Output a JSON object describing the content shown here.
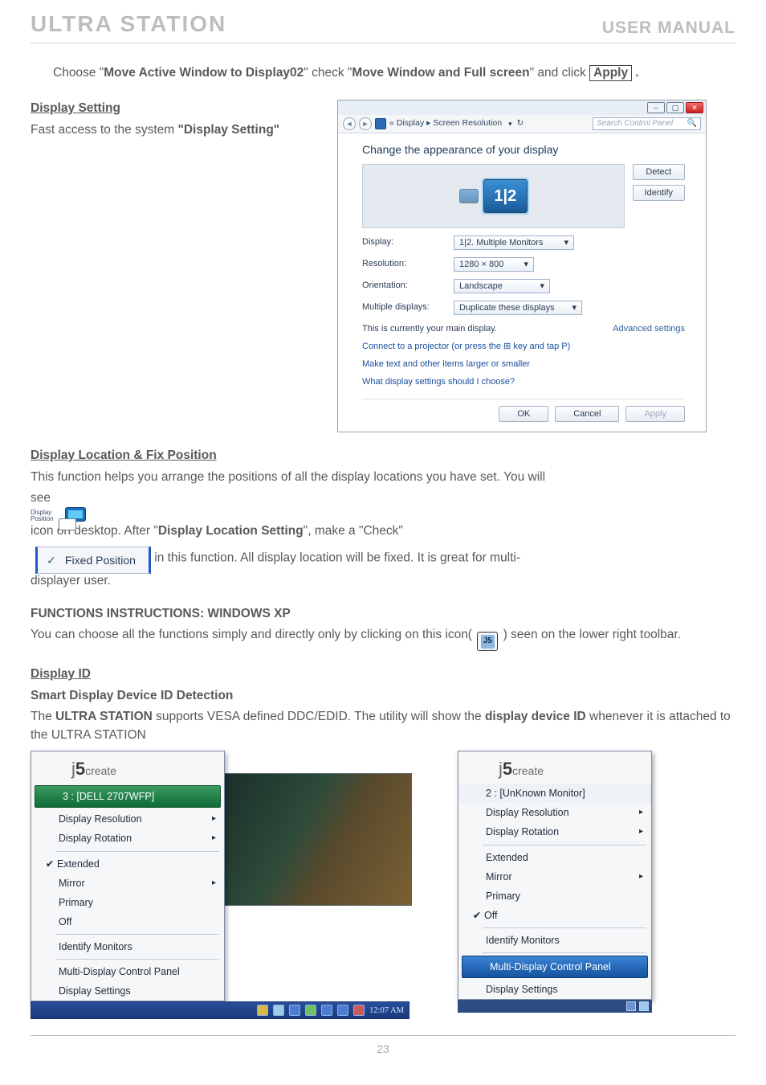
{
  "header": {
    "left": "ULTRA STATION",
    "right": "USER MANUAL"
  },
  "intro": {
    "line1a": "Choose \"",
    "line1b": "Move Active Window to Display02",
    "line1c": "\" check \"",
    "line1d": "Move Window and Full screen",
    "line1e": "\" and click ",
    "apply_label": "Apply",
    "period": " ."
  },
  "display_setting": {
    "heading": "Display Setting",
    "text_a": "Fast access to the system ",
    "text_b": "\"Display Setting\""
  },
  "sr_dialog": {
    "breadcrumb_sep1": "«  ",
    "breadcrumb_a": "Display",
    "breadcrumb_sep2": "  ▸  ",
    "breadcrumb_b": "Screen Resolution",
    "search_placeholder": "Search Control Panel",
    "heading": "Change the appearance of your display",
    "mon_combined": "1|2",
    "btn_detect": "Detect",
    "btn_identify": "Identify",
    "rows": {
      "display": {
        "label": "Display:",
        "value": "1|2. Multiple Monitors"
      },
      "resolution": {
        "label": "Resolution:",
        "value": "1280 × 800"
      },
      "orientation": {
        "label": "Orientation:",
        "value": "Landscape"
      },
      "multiple": {
        "label": "Multiple displays:",
        "value": "Duplicate these displays"
      }
    },
    "main_note": "This is currently your main display.",
    "advanced": "Advanced settings",
    "links": {
      "projector": "Connect to a projector (or press the ⊞ key and tap P)",
      "textsize": "Make text and other items larger or smaller",
      "which": "What display settings should I choose?"
    },
    "buttons": {
      "ok": "OK",
      "cancel": "Cancel",
      "apply": "Apply"
    }
  },
  "loc_fix": {
    "heading": "Display Location & Fix Position",
    "line1": "This function helps you arrange the positions of all the display locations you have set. You will",
    "see": "see ",
    "icon_caption1": "Display",
    "icon_caption2": "Position",
    "after_icon_a": "icon on desktop. After \"",
    "after_icon_b": "Display Location Setting",
    "after_icon_c": "\", make a \"Check\"",
    "fixed_position_label": "Fixed Position",
    "after_fp": "in this function. All display location will be fixed. It is great for multi-",
    "line_last": "displayer user."
  },
  "xp": {
    "heading": "FUNCTIONS INSTRUCTIONS: WINDOWS XP",
    "line_a": "You can choose all the functions simply and directly only by clicking on this icon( ",
    "j5_text": "J5",
    "line_b": " ) seen on the lower right toolbar."
  },
  "display_id": {
    "heading": "Display ID",
    "sub": "Smart Display Device ID Detection",
    "body_a": "The ",
    "body_b": "ULTRA STATION",
    "body_c": " supports VESA defined DDC/EDID. The utility will show the ",
    "body_d": "display device ID",
    "body_e": " whenever it is attached to the ULTRA STATION"
  },
  "menu1": {
    "brand_small": "j",
    "brand_big": "5",
    "brand_rest": "create",
    "head": "3 : [DELL 2707WFP]",
    "items": {
      "res": "Display Resolution",
      "rot": "Display Rotation",
      "ext": "Extended",
      "mir": "Mirror",
      "pri": "Primary",
      "off": "Off",
      "idm": "Identify Monitors",
      "mcp": "Multi-Display Control Panel",
      "dset": "Display Settings"
    },
    "time": "12:07 AM"
  },
  "menu2": {
    "head": "2 : [UnKnown Monitor]",
    "items": {
      "res": "Display Resolution",
      "rot": "Display Rotation",
      "ext": "Extended",
      "mir": "Mirror",
      "pri": "Primary",
      "off": "Off",
      "idm": "Identify Monitors",
      "mcp": "Multi-Display Control Panel",
      "dset": "Display Settings"
    }
  },
  "page": "23"
}
